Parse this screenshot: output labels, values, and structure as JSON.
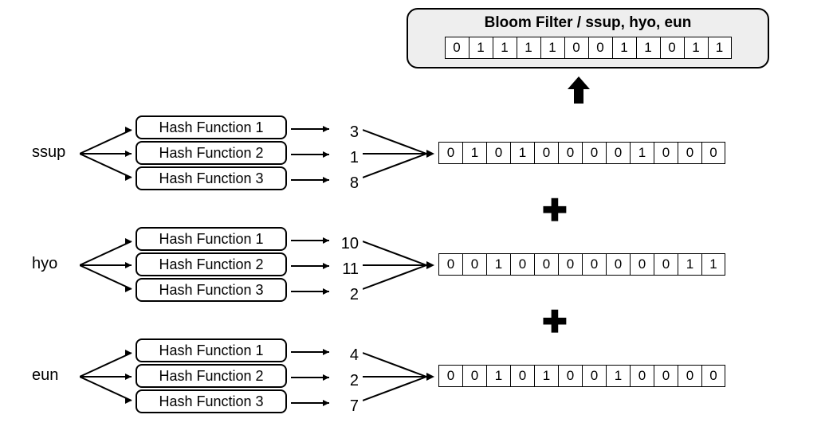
{
  "title": "Bloom Filter / ssup, hyo, eun",
  "result_bits": [
    "0",
    "1",
    "1",
    "1",
    "1",
    "0",
    "0",
    "1",
    "1",
    "0",
    "1",
    "1"
  ],
  "hash_labels": [
    "Hash Function 1",
    "Hash Function 2",
    "Hash Function 3"
  ],
  "plus": "✚",
  "rows": [
    {
      "input": "ssup",
      "outputs": [
        "3",
        "1",
        "8"
      ],
      "bits": [
        "0",
        "1",
        "0",
        "1",
        "0",
        "0",
        "0",
        "0",
        "1",
        "0",
        "0",
        "0"
      ]
    },
    {
      "input": "hyo",
      "outputs": [
        "10",
        "11",
        "2"
      ],
      "bits": [
        "0",
        "0",
        "1",
        "0",
        "0",
        "0",
        "0",
        "0",
        "0",
        "0",
        "1",
        "1"
      ]
    },
    {
      "input": "eun",
      "outputs": [
        "4",
        "2",
        "7"
      ],
      "bits": [
        "0",
        "0",
        "1",
        "0",
        "1",
        "0",
        "0",
        "1",
        "0",
        "0",
        "0",
        "0"
      ]
    }
  ]
}
